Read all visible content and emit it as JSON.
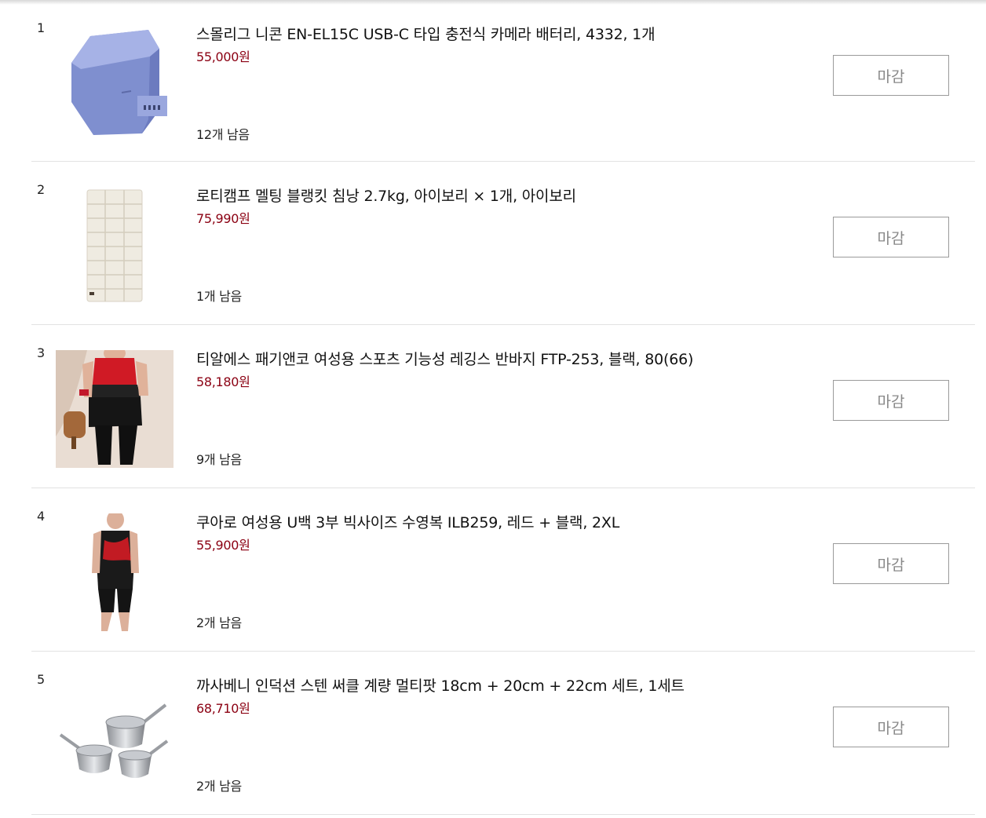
{
  "items": [
    {
      "rank": "1",
      "title": "스몰리그 니콘 EN-EL15C USB-C 타입 충전식 카메라 배터리, 4332, 1개",
      "price": "55,000원",
      "stock": "12개 남음",
      "button": "마감",
      "image_icon": "camera-battery-image"
    },
    {
      "rank": "2",
      "title": "로티캠프 멜팅 블랭킷 침낭 2.7kg, 아이보리 × 1개, 아이보리",
      "price": "75,990원",
      "stock": "1개 남음",
      "button": "마감",
      "image_icon": "sleeping-bag-image"
    },
    {
      "rank": "3",
      "title": "티알에스 패기앤코 여성용 스포츠 기능성 레깅스 반바지 FTP-253, 블랙, 80(66)",
      "price": "58,180원",
      "stock": "9개 남음",
      "button": "마감",
      "image_icon": "leggings-model-image"
    },
    {
      "rank": "4",
      "title": "쿠아로 여성용 U백 3부 빅사이즈 수영복 ILB259, 레드 + 블랙, 2XL",
      "price": "55,900원",
      "stock": "2개 남음",
      "button": "마감",
      "image_icon": "swimsuit-model-image"
    },
    {
      "rank": "5",
      "title": "까사베니 인덕션 스텐 써클 계량 멀티팟 18cm + 20cm + 22cm 세트, 1세트",
      "price": "68,710원",
      "stock": "2개 남음",
      "button": "마감",
      "image_icon": "pot-set-image"
    }
  ],
  "colors": {
    "price": "#8b0012",
    "divider": "#e2e2e2",
    "button_border": "#9a9a9a",
    "button_text": "#888888"
  }
}
